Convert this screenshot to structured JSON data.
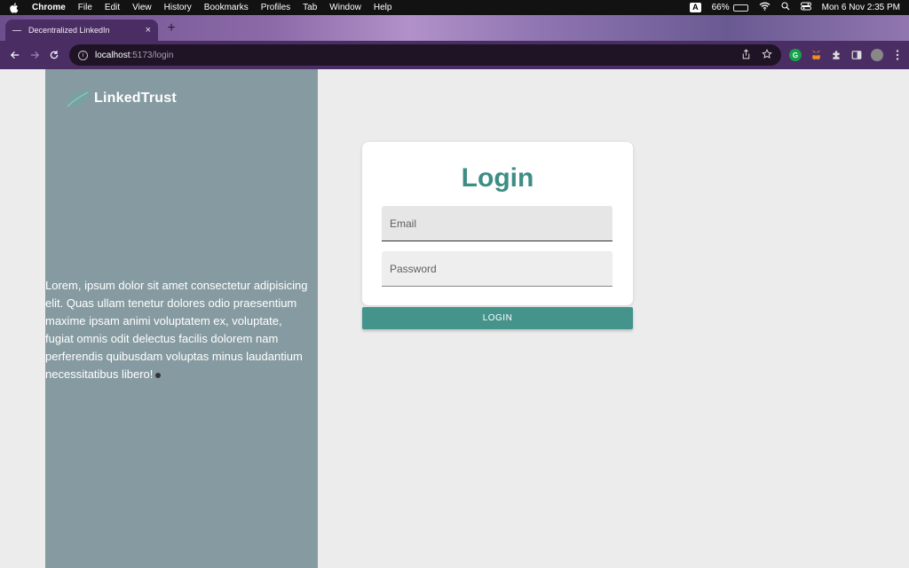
{
  "menubar": {
    "app": "Chrome",
    "items": [
      "File",
      "Edit",
      "View",
      "History",
      "Bookmarks",
      "Profiles",
      "Tab",
      "Window",
      "Help"
    ],
    "input_badge": "A",
    "battery": "66%",
    "battery_level": 0.66,
    "datetime": "Mon 6 Nov  2:35 PM"
  },
  "browser": {
    "tab_title": "Decentralized LinkedIn",
    "tab_close": "×",
    "new_tab": "+",
    "url_host": "localhost",
    "url_path": ":5173/login"
  },
  "sidebar": {
    "brand": "LinkedTrust",
    "description": "Lorem, ipsum dolor sit amet consectetur adipisicing elit. Quas ullam tenetur dolores odio praesentium maxime ipsam animi voluptatem ex, voluptate, fugiat omnis odit delectus facilis dolorem nam perferendis quibusdam voluptas minus laudantium necessitatibus libero!"
  },
  "login": {
    "title": "Login",
    "email_placeholder": "Email",
    "password_placeholder": "Password",
    "button": "LOGIN"
  },
  "colors": {
    "accent": "#44948b",
    "title": "#3d8d85",
    "sidebar": "#869ba1"
  }
}
